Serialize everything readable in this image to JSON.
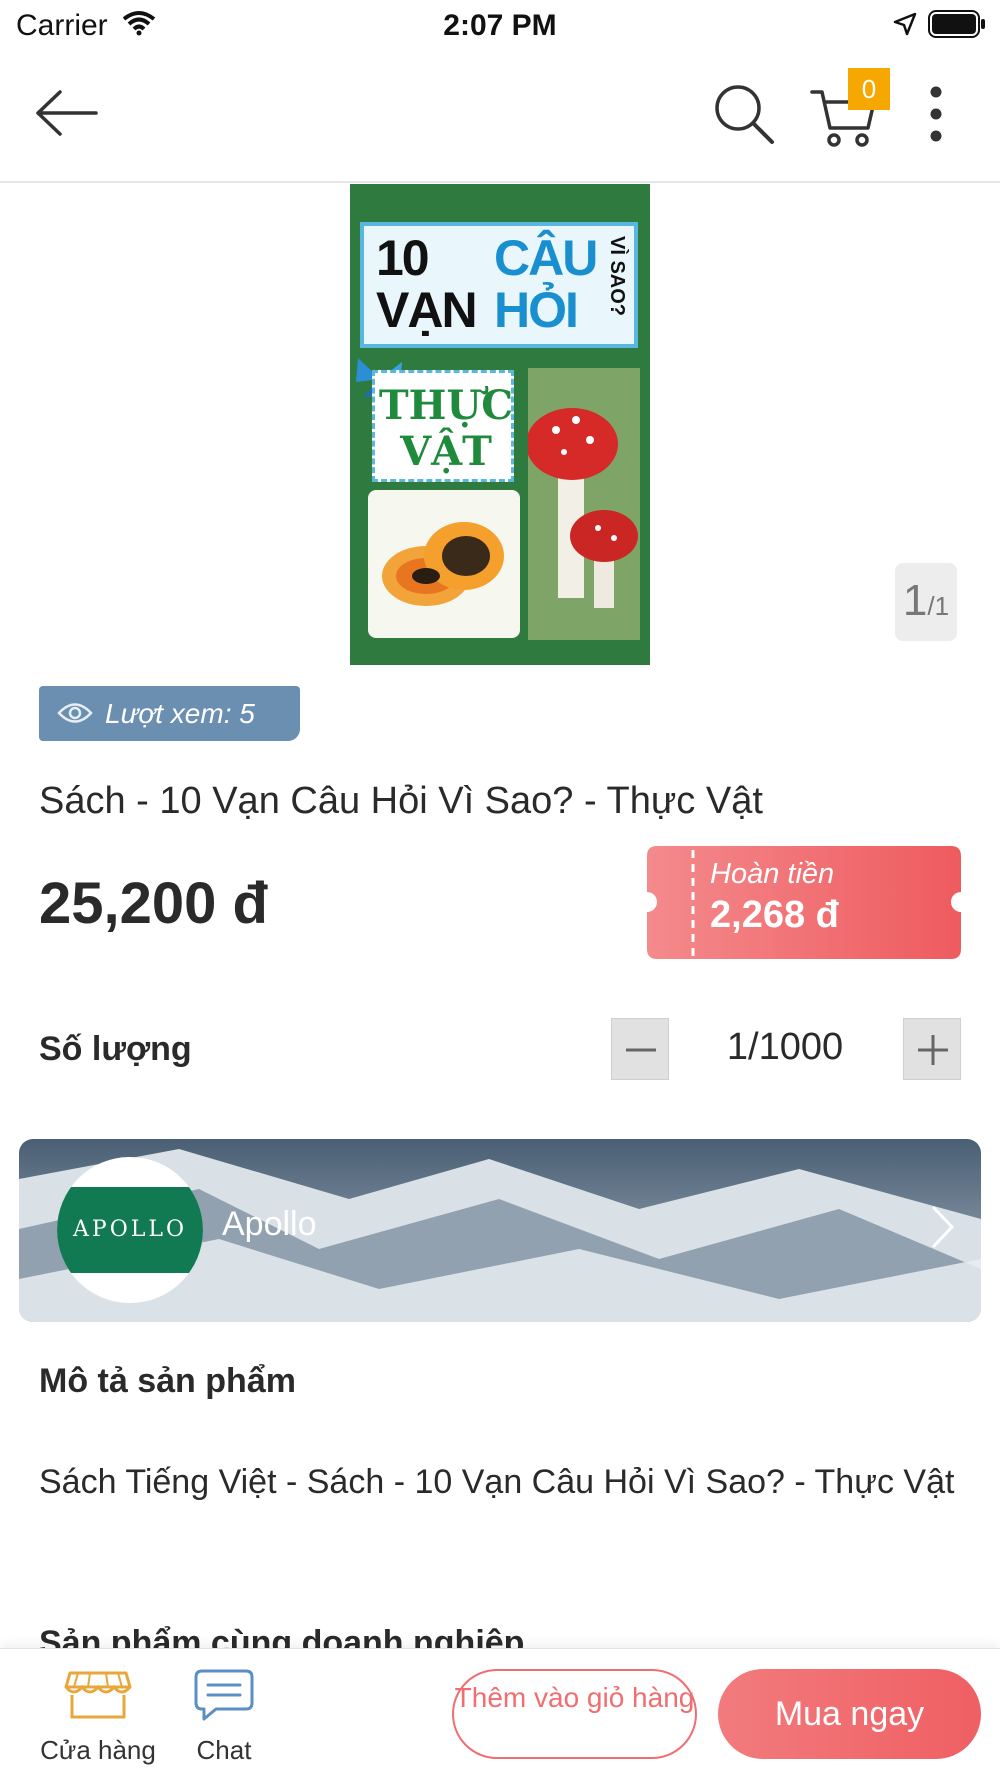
{
  "status_bar": {
    "carrier": "Carrier",
    "time": "2:07 PM"
  },
  "header": {
    "back_icon": "arrow-left-icon",
    "search_icon": "search-icon",
    "cart_icon": "cart-icon",
    "cart_count": "0",
    "more_icon": "more-vertical-icon"
  },
  "gallery": {
    "cover_title_left": "10 VẠN",
    "cover_title_right": "CÂU HỎI",
    "cover_title_vertical": "VÌ SAO?",
    "cover_subtitle": "THỰC VẬT",
    "counter_current": "1",
    "counter_total": "/1"
  },
  "product": {
    "views_text": "Lượt xem: 5",
    "title": "Sách - 10 Vạn Câu Hỏi Vì Sao? - Thực Vật",
    "price": "25,200 đ",
    "cashback_label": "Hoàn tiền",
    "cashback_amount": "2,268 đ",
    "quantity_label": "Số lượng",
    "quantity_value": "1/1000"
  },
  "store": {
    "logo_text": "APOLLO",
    "name": "Apollo"
  },
  "description": {
    "heading": "Mô tả sản phẩm",
    "text": "Sách Tiếng Việt - Sách - 10 Vạn Câu Hỏi Vì Sao? - Thực Vật",
    "related_heading": "Sản phẩm cùng doanh nghiệp"
  },
  "bottom_bar": {
    "store_label": "Cửa hàng",
    "chat_label": "Chat",
    "add_to_cart": "Thêm vào giỏ hàng",
    "buy_now": "Mua ngay"
  },
  "colors": {
    "accent": "#ef5f63",
    "badge": "#f7a800",
    "views_pill": "#6a8fb0",
    "store_green": "#127a52"
  }
}
